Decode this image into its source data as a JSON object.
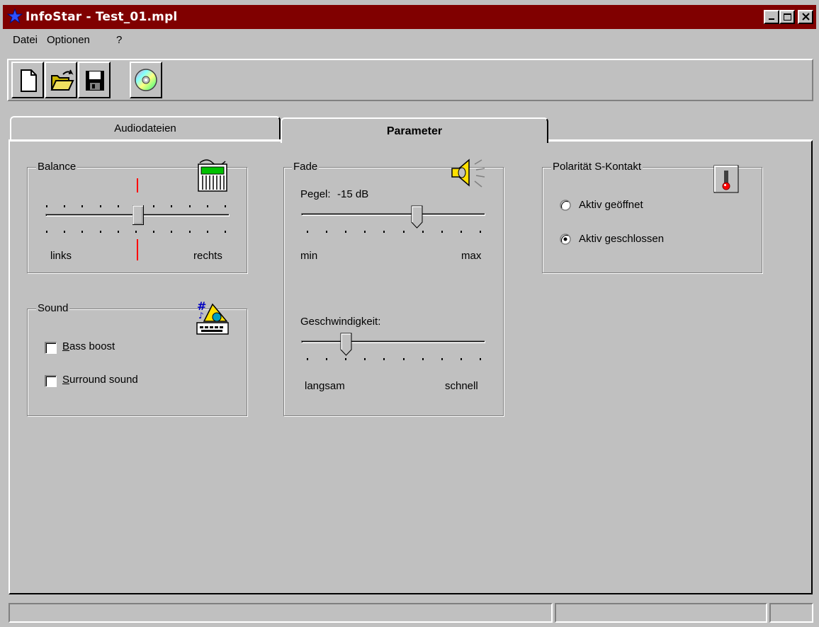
{
  "window": {
    "title": "InfoStar - Test_01.mpl"
  },
  "menu": {
    "items": [
      {
        "label": "Datei"
      },
      {
        "label": "Optionen"
      },
      {
        "label": "?"
      }
    ]
  },
  "toolbar": {
    "buttons": [
      {
        "icon": "new-document-icon"
      },
      {
        "icon": "open-folder-icon"
      },
      {
        "icon": "save-disk-icon"
      },
      {
        "icon": "cd-icon"
      }
    ]
  },
  "tabs": [
    {
      "label": "Audiodateien",
      "active": false
    },
    {
      "label": "Parameter",
      "active": true
    }
  ],
  "balance": {
    "label": "Balance",
    "left_label": "links",
    "right_label": "rechts",
    "value": 0.5
  },
  "sound": {
    "label": "Sound",
    "bass_boost": {
      "label": "Bass boost",
      "checked": false
    },
    "surround": {
      "label": "Surround sound",
      "checked": false
    }
  },
  "fade": {
    "label": "Fade",
    "pegel_label": "Pegel:",
    "pegel_value": "-15 dB",
    "pegel_min": "min",
    "pegel_max": "max",
    "speed_label": "Geschwindigkeit:",
    "speed_min": "langsam",
    "speed_max": "schnell"
  },
  "polarity": {
    "label": "Polarität S-Kontakt",
    "options": [
      {
        "label": "Aktiv geöffnet",
        "selected": false
      },
      {
        "label": "Aktiv geschlossen",
        "selected": true
      }
    ]
  },
  "colors": {
    "titlebar": "#800000",
    "face": "#c0c0c0",
    "center_marker": "#ff0000"
  }
}
